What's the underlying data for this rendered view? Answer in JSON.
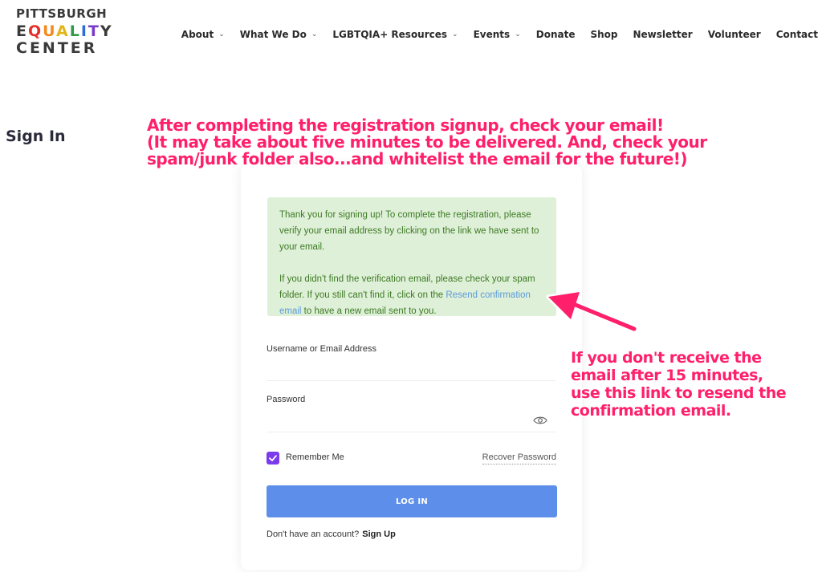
{
  "logo": {
    "line1": "PITTSBURGH",
    "line2_letters": [
      "E",
      "Q",
      "U",
      "A",
      "L",
      "I",
      "T",
      "Y"
    ],
    "line3": "CENTER"
  },
  "nav": {
    "items": [
      {
        "label": "About",
        "dropdown": true
      },
      {
        "label": "What We Do",
        "dropdown": true
      },
      {
        "label": "LGBTQIA+ Resources",
        "dropdown": true
      },
      {
        "label": "Events",
        "dropdown": true
      },
      {
        "label": "Donate",
        "dropdown": false
      },
      {
        "label": "Shop",
        "dropdown": false
      },
      {
        "label": "Newsletter",
        "dropdown": false
      },
      {
        "label": "Volunteer",
        "dropdown": false
      },
      {
        "label": "Contact",
        "dropdown": false
      }
    ],
    "chevron": "⌄"
  },
  "page_title": "Sign In",
  "notice": {
    "p1": "Thank you for signing up! To complete the registration, please verify your email address by clicking on the link we have sent to your email.",
    "p2_before": "If you didn't find the verification email, please check your spam folder. If you still can't find it, click on the ",
    "p2_link": "Resend confirmation email",
    "p2_after": " to have a new email sent to you."
  },
  "form": {
    "username_label": "Username or Email Address",
    "username_value": "",
    "password_label": "Password",
    "password_value": "",
    "password_toggle_icon": "eye-icon",
    "remember_label": "Remember Me",
    "remember_checked": true,
    "recover_label": "Recover Password",
    "login_label": "LOG IN",
    "no_account_text": "Don't have an account?",
    "signup_label": "Sign Up"
  },
  "annotations": {
    "top": [
      "After completing the registration signup, check your email!",
      "(It may take about five minutes to be delivered. And, check your",
      "spam/junk folder also...and whitelist the email for the future!)"
    ],
    "side": [
      "If you don't receive the",
      "email after 15 minutes,",
      "use this link to resend the",
      "confirmation email."
    ]
  },
  "colors": {
    "accent_purple": "#7c3aed",
    "button_blue": "#5c8eea",
    "notice_bg": "#dff0d8",
    "notice_text": "#3c7a24",
    "link_blue": "#5b9ad8",
    "annotation_pink": "#ff1f6a"
  }
}
